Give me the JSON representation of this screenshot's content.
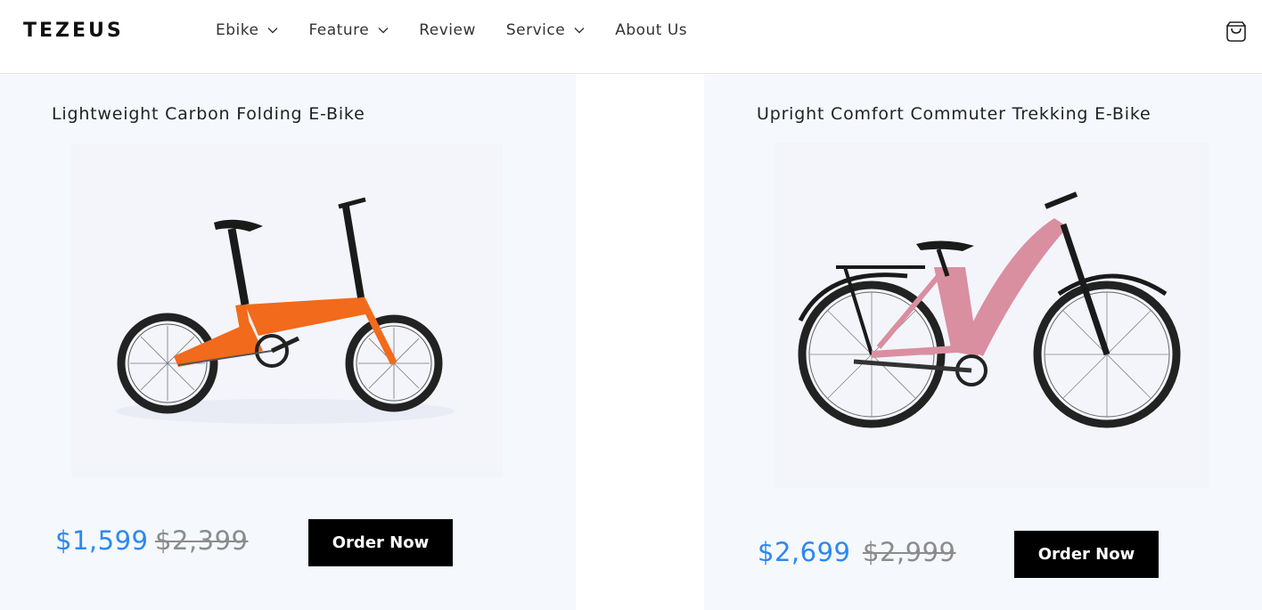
{
  "brand": {
    "name": "TEZEUS"
  },
  "nav": {
    "items": [
      {
        "label": "Ebike",
        "has_dropdown": true
      },
      {
        "label": "Feature",
        "has_dropdown": true
      },
      {
        "label": "Review",
        "has_dropdown": false
      },
      {
        "label": "Service",
        "has_dropdown": true
      },
      {
        "label": "About Us",
        "has_dropdown": false
      }
    ]
  },
  "header": {
    "cart_icon": "shopping-bag-icon"
  },
  "products": [
    {
      "title": "Lightweight Carbon Folding E-Bike",
      "price": "$1,599",
      "original_price": "$2,399",
      "button_label": "Order Now",
      "frame_color": "#f26a1b",
      "image_icon": "folding-ebike-image"
    },
    {
      "title": "Upright Comfort Commuter Trekking E-Bike",
      "price": "$2,699",
      "original_price": "$2,999",
      "button_label": "Order Now",
      "frame_color": "#d98fa0",
      "image_icon": "commuter-ebike-image"
    }
  ],
  "colors": {
    "accent_price": "#2d88f0",
    "strike_price": "#8c8c8c",
    "button_bg": "#000000",
    "card_bg": "#f5f8fd"
  }
}
